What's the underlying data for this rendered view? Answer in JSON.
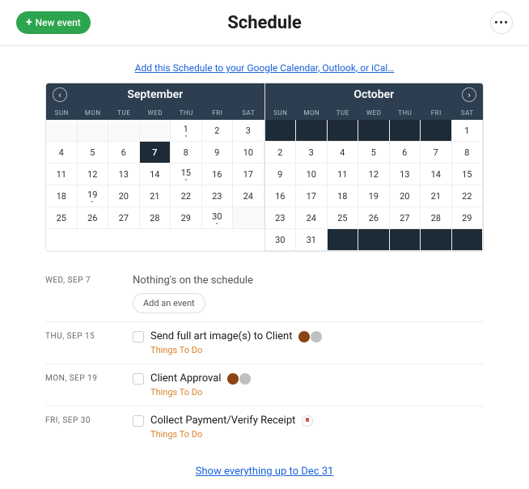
{
  "header": {
    "new_event": "New event",
    "title": "Schedule"
  },
  "link": "Add this Schedule to your Google Calendar, Outlook, or iCal…",
  "months": [
    {
      "name": "September",
      "days": [
        null,
        null,
        null,
        null,
        1,
        2,
        3,
        4,
        5,
        6,
        7,
        8,
        9,
        10,
        11,
        12,
        13,
        14,
        15,
        16,
        17,
        18,
        19,
        20,
        21,
        22,
        23,
        24,
        25,
        26,
        27,
        28,
        29,
        30,
        null
      ],
      "selected": 7,
      "dots": [
        1,
        15,
        19,
        30
      ]
    },
    {
      "name": "October",
      "days": [
        null,
        null,
        null,
        null,
        null,
        null,
        1,
        2,
        3,
        4,
        5,
        6,
        7,
        8,
        9,
        10,
        11,
        12,
        13,
        14,
        15,
        16,
        17,
        18,
        19,
        20,
        21,
        22,
        23,
        24,
        25,
        26,
        27,
        28,
        29,
        30,
        31,
        null,
        null,
        null,
        null,
        null
      ],
      "selected": null,
      "dots": []
    }
  ],
  "dow": [
    "SUN",
    "MON",
    "TUE",
    "WED",
    "THU",
    "FRI",
    "SAT"
  ],
  "events": [
    {
      "date": "WED, SEP 7",
      "empty": true,
      "empty_msg": "Nothing's on the schedule",
      "add_label": "Add an event"
    },
    {
      "date": "THU, SEP 15",
      "title": "Send full art image(s) to Client",
      "cat": "Things To Do",
      "avatars": [
        "av1",
        "av2"
      ]
    },
    {
      "date": "MON, SEP 19",
      "title": "Client Approval",
      "cat": "Things To Do",
      "avatars": [
        "av1",
        "av2"
      ]
    },
    {
      "date": "FRI, SEP 30",
      "title": "Collect Payment/Verify Receipt",
      "cat": "Things To Do",
      "avatars": [
        "av3"
      ]
    }
  ],
  "showmore": "Show everything up to Dec 31"
}
